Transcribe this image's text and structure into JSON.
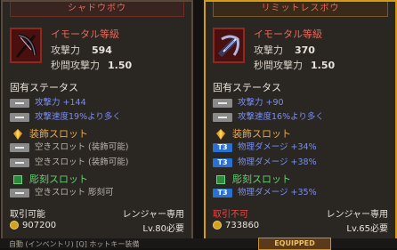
{
  "left_card": {
    "title": "シャドウボウ",
    "rarity": "イモータル等級",
    "attack_label": "攻撃力",
    "attack_value": "594",
    "speed_label": "秒間攻撃力",
    "speed_value": "1.50",
    "inherent_title": "固有ステータス",
    "inherent": [
      {
        "text": "攻撃力 +144"
      },
      {
        "text": "攻撃速度19%より多く"
      }
    ],
    "deco_title": "装飾スロット",
    "deco_slots": [
      {
        "text": "空きスロット (装飾可能)"
      },
      {
        "text": "空きスロット (装飾可能)"
      }
    ],
    "engrave_title": "彫刻スロット",
    "engrave_slots": [
      {
        "text": "空きスロット 彫刻可"
      }
    ],
    "tradeable": "取引可能",
    "class_only": "レンジャー専用",
    "price": "907200",
    "level_req": "Lv.80必要"
  },
  "right_card": {
    "title": "リミットレスボウ",
    "rarity": "イモータル等級",
    "attack_label": "攻撃力",
    "attack_value": "370",
    "speed_label": "秒間攻撃力",
    "speed_value": "1.50",
    "inherent_title": "固有ステータス",
    "inherent": [
      {
        "text": "攻撃力 +90"
      },
      {
        "text": "攻撃速度16%より多く"
      }
    ],
    "deco_title": "装飾スロット",
    "deco_slots": [
      {
        "tag": "T3",
        "text": "物理ダメージ +34%"
      },
      {
        "tag": "T3",
        "text": "物理ダメージ +38%"
      }
    ],
    "engrave_title": "彫刻スロット",
    "engrave_slots": [
      {
        "tag": "T3",
        "text": "物理ダメージ +35%"
      }
    ],
    "tradeable": "取引不可",
    "class_only": "レンジャー専用",
    "price": "733860",
    "level_req": "Lv.65必要"
  },
  "bottom": {
    "text": "自動 (インベントリ)   [Q] ホットキー装備",
    "badge": "EQUIPPED"
  },
  "colors": {
    "rarity_red": "#e86858",
    "stat_blue": "#7a8ef0",
    "gold_border": "#d49a1c"
  }
}
